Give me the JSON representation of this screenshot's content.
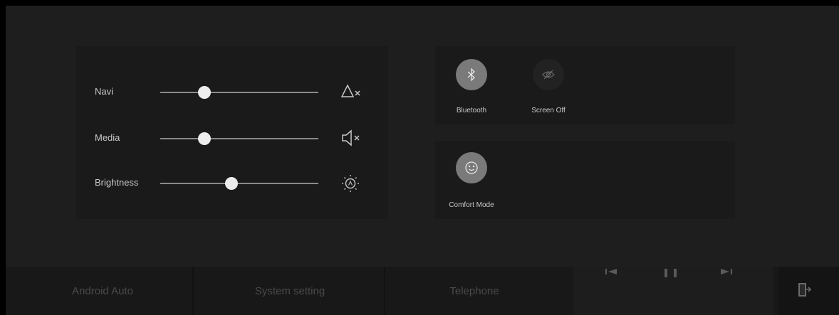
{
  "sliders": [
    {
      "label": "Navi",
      "level": 0.28,
      "icon": "navi-mute-icon"
    },
    {
      "label": "Media",
      "level": 0.28,
      "icon": "media-mute-icon"
    },
    {
      "label": "Brightness",
      "level": 0.45,
      "icon": "brightness-auto-icon"
    }
  ],
  "toggles": {
    "bluetooth": {
      "label": "Bluetooth",
      "icon": "bluetooth-icon"
    },
    "screen_off": {
      "label": "Screen Off",
      "icon": "screen-off-icon"
    },
    "comfort_mode": {
      "label": "Comfort Mode",
      "icon": "comfort-mode-icon"
    }
  },
  "bottom_bar": {
    "items": [
      "Android Auto",
      "System setting",
      "Telephone"
    ],
    "media_controls": [
      "previous-icon",
      "pause-icon",
      "next-icon"
    ],
    "exit_icon": "exit-icon"
  },
  "colors": {
    "background": "#202020",
    "panel": "#1a1a1a",
    "toggle_active": "#7a7a7a",
    "toggle_inactive": "#222222",
    "text": "#c8c8c8"
  }
}
